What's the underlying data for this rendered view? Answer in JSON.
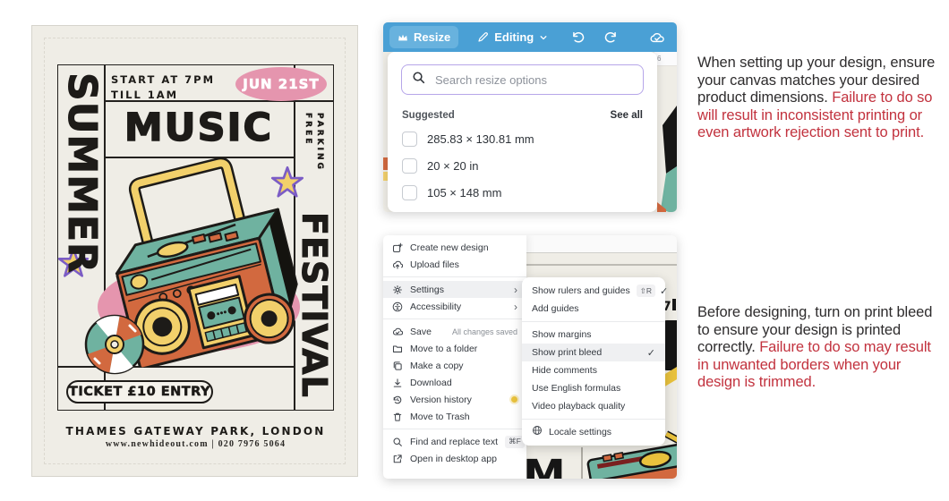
{
  "poster": {
    "side_left": "SUMMER",
    "schedule_line1": "START AT 7PM",
    "schedule_line2": "TILL 1AM",
    "date_badge": "JUN 21ST",
    "headline": "MUSIC",
    "parking_word1": "FREE",
    "parking_word2": "PARKING",
    "side_right": "FESTIVAL",
    "ticket_pill": "TICKET £10 ENTRY",
    "venue_line": "THAMES GATEWAY PARK, LONDON",
    "contact_line": "www.newhideout.com | 020 7976 5064",
    "colors": {
      "background": "#efede6",
      "pink": "#e595ae",
      "teal": "#6fb2a0",
      "orange": "#d2693f",
      "yellow": "#f2d06b",
      "ink": "#1d1b18",
      "star_outline": "#7b5cc5"
    }
  },
  "resize_shot": {
    "toolbar": {
      "resize_label": "Resize",
      "editing_label": "Editing"
    },
    "search_placeholder": "Search resize options",
    "suggested_label": "Suggested",
    "see_all_label": "See all",
    "options": [
      {
        "label": "285.83 × 130.81 mm"
      },
      {
        "label": "20 × 20 in"
      },
      {
        "label": "105 × 148 mm"
      }
    ],
    "ruler_mark": "6",
    "toolbar_color": "#4aa0d5",
    "search_border_color": "#b6a6e9"
  },
  "menu_shot": {
    "items": [
      {
        "label": "Create new design"
      },
      {
        "label": "Upload files"
      },
      {
        "label": "Settings"
      },
      {
        "label": "Accessibility"
      },
      {
        "label": "Save",
        "right": "All changes saved"
      },
      {
        "label": "Move to a folder"
      },
      {
        "label": "Make a copy"
      },
      {
        "label": "Download"
      },
      {
        "label": "Version history"
      },
      {
        "label": "Move to Trash"
      },
      {
        "label": "Find and replace text",
        "shortcut": "⌘F"
      },
      {
        "label": "Open in desktop app"
      }
    ],
    "submenu": {
      "items": [
        {
          "label": "Show rulers and guides",
          "shortcut": "⇧R",
          "check": "✓"
        },
        {
          "label": "Add guides"
        },
        {
          "label": "Show margins"
        },
        {
          "label": "Show print bleed",
          "check": "✓"
        },
        {
          "label": "Hide comments"
        },
        {
          "label": "Use English formulas"
        },
        {
          "label": "Video playback quality"
        },
        {
          "label": "Locale settings"
        }
      ]
    }
  },
  "notes": [
    {
      "body": "When setting up your design, ensure your canvas matches your desired product dimensions. ",
      "warning": "Failure to do so will result in inconsistent printing or even artwork rejection sent to print."
    },
    {
      "body": "Before designing, turn on print bleed to ensure your design is printed correctly. ",
      "warning": "Failure to do so may result in unwanted borders when your design is trimmed."
    }
  ],
  "warning_color": "#c2323e"
}
